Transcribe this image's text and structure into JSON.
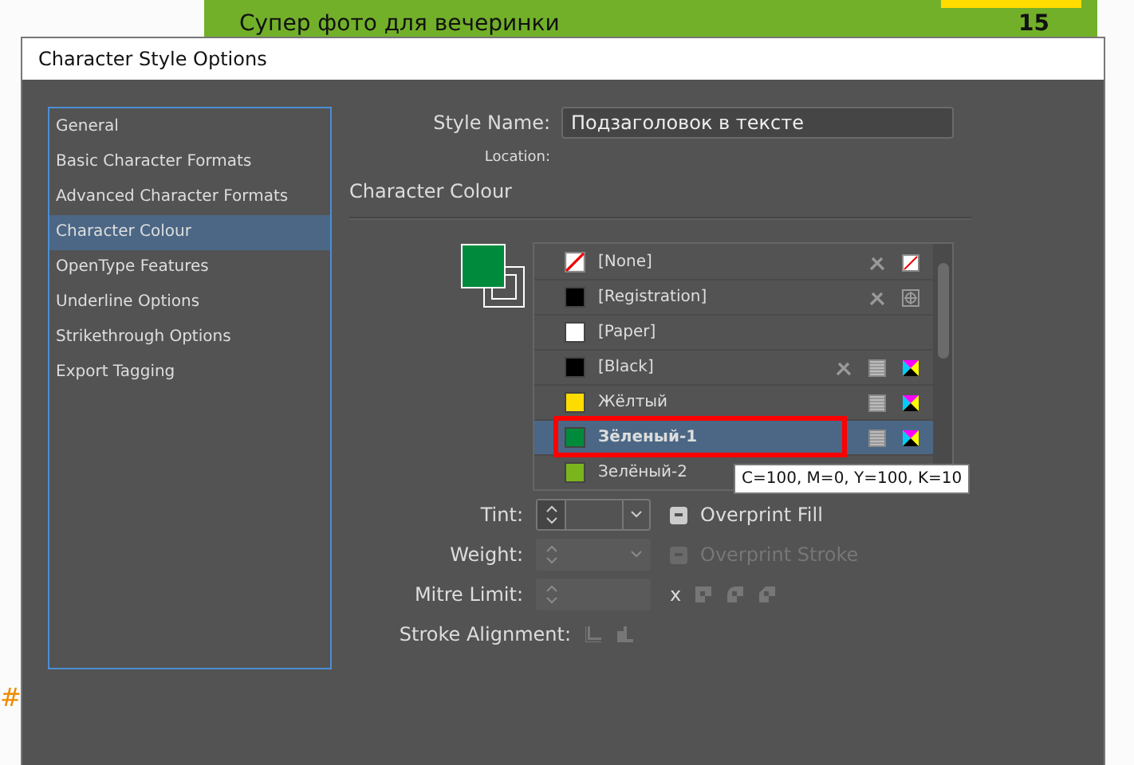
{
  "document": {
    "headline": "Супер фото для вечеринки",
    "page_number": "15",
    "margin_glyph": "#"
  },
  "window": {
    "title": "Character Style Options"
  },
  "sidebar": {
    "items": [
      {
        "label": "General",
        "selected": false
      },
      {
        "label": "Basic Character Formats",
        "selected": false
      },
      {
        "label": "Advanced Character Formats",
        "selected": false
      },
      {
        "label": "Character Colour",
        "selected": true
      },
      {
        "label": "OpenType Features",
        "selected": false
      },
      {
        "label": "Underline Options",
        "selected": false
      },
      {
        "label": "Strikethrough Options",
        "selected": false
      },
      {
        "label": "Export Tagging",
        "selected": false
      }
    ]
  },
  "style_name": {
    "label": "Style Name:",
    "value": "Подзаголовок в тексте"
  },
  "location": {
    "label": "Location:"
  },
  "section_title": "Character Colour",
  "swatches": [
    {
      "name": "[None]",
      "kind": "none",
      "locked": true,
      "selected": false
    },
    {
      "name": "[Registration]",
      "kind": "registration",
      "color": "#000000",
      "locked": true,
      "selected": false
    },
    {
      "name": "[Paper]",
      "kind": "paper",
      "color": "#ffffff",
      "locked": false,
      "selected": false
    },
    {
      "name": "[Black]",
      "kind": "process",
      "color": "#000000",
      "locked": true,
      "selected": false
    },
    {
      "name": "Жёлтый",
      "kind": "process",
      "color": "#ffdc00",
      "locked": false,
      "selected": false
    },
    {
      "name": "Зёленый-1",
      "kind": "process",
      "color": "#008b3c",
      "locked": false,
      "selected": true
    },
    {
      "name": "Зелёный-2",
      "kind": "process",
      "color": "#7ab51d",
      "locked": false,
      "selected": false
    }
  ],
  "tooltip": "C=100, M=0, Y=100, K=10",
  "tint": {
    "label": "Tint:",
    "disabled": false
  },
  "overprint_fill": {
    "label": "Overprint Fill",
    "disabled": false
  },
  "weight": {
    "label": "Weight:",
    "disabled": true
  },
  "overprint_stroke": {
    "label": "Overprint Stroke",
    "disabled": true
  },
  "mitre_limit": {
    "label": "Mitre Limit:",
    "unit": "x"
  },
  "stroke_alignment": {
    "label": "Stroke Alignment:"
  }
}
